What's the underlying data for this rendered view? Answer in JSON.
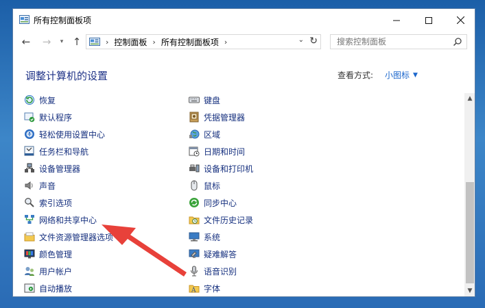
{
  "window": {
    "title": "所有控制面板项"
  },
  "nav": {
    "breadcrumb": [
      "控制面板",
      "所有控制面板项"
    ],
    "search_placeholder": "搜索控制面板"
  },
  "header": {
    "title": "调整计算机的设置",
    "view_label": "查看方式:",
    "view_value": "小图标"
  },
  "items_left": [
    {
      "label": "恢复",
      "icon": "recovery-icon"
    },
    {
      "label": "默认程序",
      "icon": "default-programs-icon"
    },
    {
      "label": "轻松使用设置中心",
      "icon": "ease-of-access-icon"
    },
    {
      "label": "任务栏和导航",
      "icon": "taskbar-icon"
    },
    {
      "label": "设备管理器",
      "icon": "device-manager-icon"
    },
    {
      "label": "声音",
      "icon": "sound-icon"
    },
    {
      "label": "索引选项",
      "icon": "indexing-icon"
    },
    {
      "label": "网络和共享中心",
      "icon": "network-icon"
    },
    {
      "label": "文件资源管理器选项",
      "icon": "folder-options-icon"
    },
    {
      "label": "颜色管理",
      "icon": "color-management-icon"
    },
    {
      "label": "用户帐户",
      "icon": "user-accounts-icon"
    },
    {
      "label": "自动播放",
      "icon": "autoplay-icon"
    }
  ],
  "items_right": [
    {
      "label": "键盘",
      "icon": "keyboard-icon"
    },
    {
      "label": "凭据管理器",
      "icon": "credential-manager-icon"
    },
    {
      "label": "区域",
      "icon": "region-icon"
    },
    {
      "label": "日期和时间",
      "icon": "date-time-icon"
    },
    {
      "label": "设备和打印机",
      "icon": "devices-printers-icon"
    },
    {
      "label": "鼠标",
      "icon": "mouse-icon"
    },
    {
      "label": "同步中心",
      "icon": "sync-center-icon"
    },
    {
      "label": "文件历史记录",
      "icon": "file-history-icon"
    },
    {
      "label": "系统",
      "icon": "system-icon"
    },
    {
      "label": "疑难解答",
      "icon": "troubleshooting-icon"
    },
    {
      "label": "语音识别",
      "icon": "speech-recognition-icon"
    },
    {
      "label": "字体",
      "icon": "fonts-icon"
    }
  ],
  "colors": {
    "link": "#16307f",
    "accent": "#1a66cc",
    "annotation_arrow": "#e8413a"
  }
}
